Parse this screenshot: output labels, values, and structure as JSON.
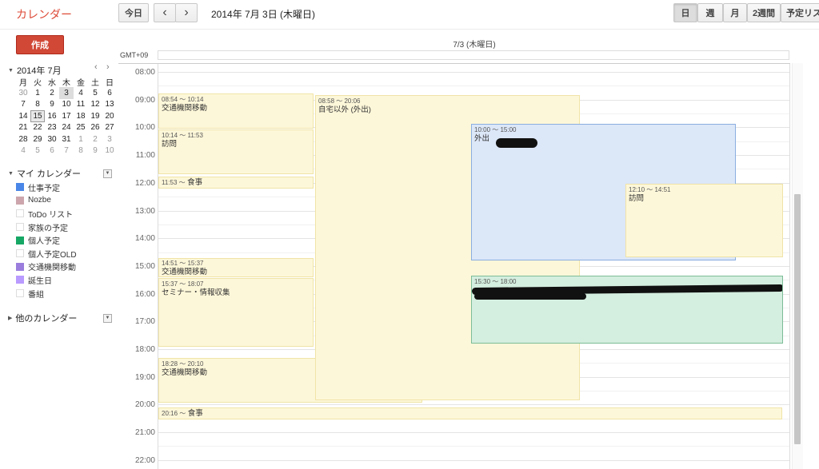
{
  "app": {
    "title": "カレンダー",
    "accent": "#dd4b39"
  },
  "toolbar": {
    "today_label": "今日",
    "prev_icon": "‹",
    "next_icon": "›",
    "date_label": "2014年 7月 3日 (木曜日)",
    "views": [
      "日",
      "週",
      "月",
      "2週間",
      "予定リス"
    ],
    "selected_view": "日"
  },
  "sidebar": {
    "create_label": "作成",
    "mini_cal": {
      "title": "2014年 7月",
      "prev": "‹",
      "next": "›",
      "weekdays": [
        "月",
        "火",
        "水",
        "木",
        "金",
        "土",
        "日"
      ],
      "weeks": [
        [
          "30",
          "1",
          "2",
          "3",
          "4",
          "5",
          "6"
        ],
        [
          "7",
          "8",
          "9",
          "10",
          "11",
          "12",
          "13"
        ],
        [
          "14",
          "15",
          "16",
          "17",
          "18",
          "19",
          "20"
        ],
        [
          "21",
          "22",
          "23",
          "24",
          "25",
          "26",
          "27"
        ],
        [
          "28",
          "29",
          "30",
          "31",
          "1",
          "2",
          "3"
        ],
        [
          "4",
          "5",
          "6",
          "7",
          "8",
          "9",
          "10"
        ]
      ]
    },
    "my_calendars_title": "マイ カレンダー",
    "my_calendars": [
      {
        "label": "仕事予定",
        "color": "#4986e7"
      },
      {
        "label": "Nozbe",
        "color": "#cca6ac"
      },
      {
        "label": "ToDo リスト",
        "color": ""
      },
      {
        "label": "家族の予定",
        "color": ""
      },
      {
        "label": "個人予定",
        "color": "#16a765"
      },
      {
        "label": "個人予定OLD",
        "color": ""
      },
      {
        "label": "交通機関移動",
        "color": "#9a7ddd"
      },
      {
        "label": "誕生日",
        "color": "#b99aff"
      },
      {
        "label": "番組",
        "color": ""
      }
    ],
    "other_calendars_title": "他のカレンダー"
  },
  "day_view": {
    "column_header": "7/3 (木曜日)",
    "timezone": "GMT+09",
    "hours": [
      "08:00",
      "09:00",
      "10:00",
      "11:00",
      "12:00",
      "13:00",
      "14:00",
      "15:00",
      "16:00",
      "17:00",
      "18:00",
      "19:00",
      "20:00",
      "21:00",
      "22:00"
    ],
    "events": [
      {
        "time": "08:54 〜 10:14",
        "title": "交通機関移動"
      },
      {
        "time": "10:14 〜 11:53",
        "title": "訪問"
      },
      {
        "time": "11:53 〜",
        "title": "食事"
      },
      {
        "time": "14:51 〜 15:37",
        "title": "交通機関移動"
      },
      {
        "time": "15:37 〜 18:07",
        "title": "セミナー・情報収集"
      },
      {
        "time": "18:28 〜 20:10",
        "title": "交通機関移動"
      },
      {
        "time": "08:58 〜 20:06",
        "title": "自宅以外 (外出)"
      },
      {
        "time": "10:00 〜 15:00",
        "title": "外出"
      },
      {
        "time": "12:10 〜 14:51",
        "title": "訪問"
      },
      {
        "time": "15:30 〜 18:00",
        "title": ""
      },
      {
        "time": "20:16 〜",
        "title": "食事"
      }
    ]
  }
}
